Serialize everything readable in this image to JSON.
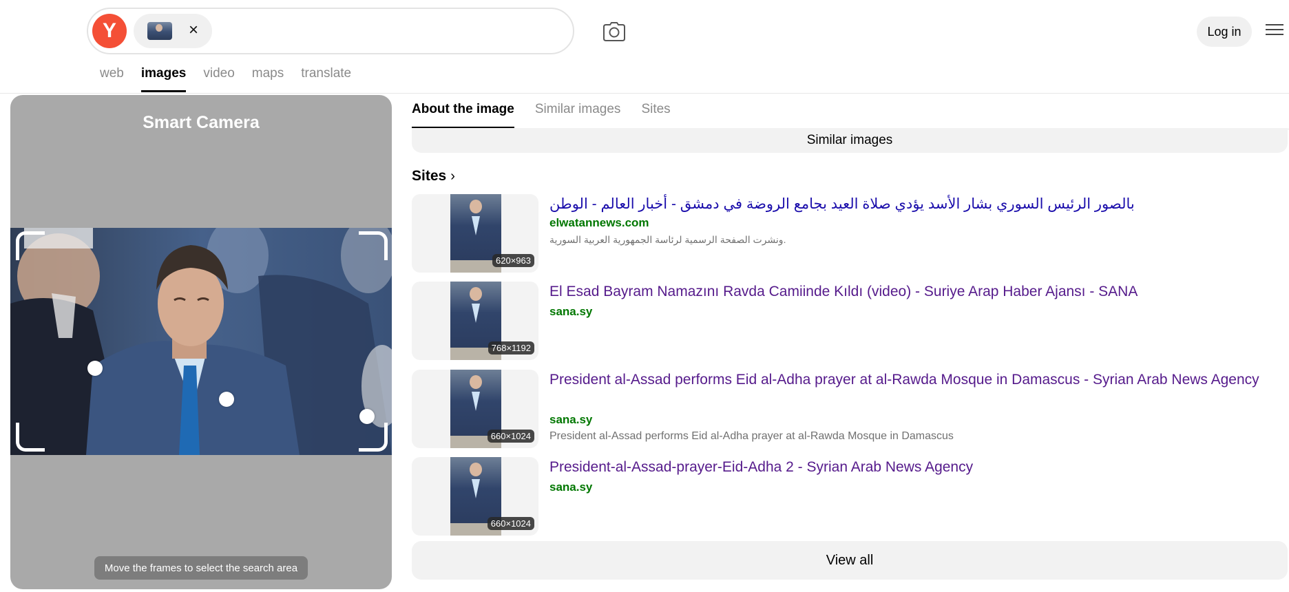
{
  "header": {
    "logo_letter": "Y",
    "login_label": "Log in"
  },
  "nav": {
    "items": [
      {
        "label": "web",
        "active": false
      },
      {
        "label": "images",
        "active": true
      },
      {
        "label": "video",
        "active": false
      },
      {
        "label": "maps",
        "active": false
      },
      {
        "label": "translate",
        "active": false
      }
    ]
  },
  "smart_camera": {
    "title": "Smart Camera",
    "hint": "Move the frames to select the search area"
  },
  "tabs": [
    {
      "label": "About the image",
      "active": true
    },
    {
      "label": "Similar images",
      "active": false
    },
    {
      "label": "Sites",
      "active": false
    }
  ],
  "similar_images_bar": "Similar images",
  "sites": {
    "heading": "Sites",
    "items": [
      {
        "title": "بالصور الرئيس السوري بشار الأسد يؤدي صلاة العيد بجامع الروضة في دمشق - أخبار العالم - الوطن",
        "domain": "elwatannews.com",
        "description": ".ونشرت الصفحة الرسمية لرئاسة الجمهورية العربية السورية",
        "dimensions": "620×963"
      },
      {
        "title": "El Esad Bayram Namazını Ravda Camiinde Kıldı (video) - Suriye Arap Haber Ajansı - SANA",
        "domain": "sana.sy",
        "description": "",
        "dimensions": "768×1192"
      },
      {
        "title": "President al-Assad performs Eid al-Adha prayer at al-Rawda Mosque in Damascus - Syrian Arab News Agency",
        "domain": "sana.sy",
        "description": "President al-Assad performs Eid al-Adha prayer at al-Rawda Mosque in Damascus",
        "dimensions": "660×1024"
      },
      {
        "title": "President-al-Assad-prayer-Eid-Adha 2 - Syrian Arab News Agency",
        "domain": "sana.sy",
        "description": "",
        "dimensions": "660×1024"
      }
    ],
    "view_all_label": "View all"
  },
  "colors": {
    "brand": "#f44f36",
    "link_visited": "#551a8b",
    "domain_green": "#007700"
  },
  "icons": {
    "logo": "yandex-logo-icon",
    "chip_close": "close-icon",
    "camera": "camera-search-icon",
    "menu": "hamburger-menu-icon",
    "sites_chevron": "chevron-right-icon"
  }
}
